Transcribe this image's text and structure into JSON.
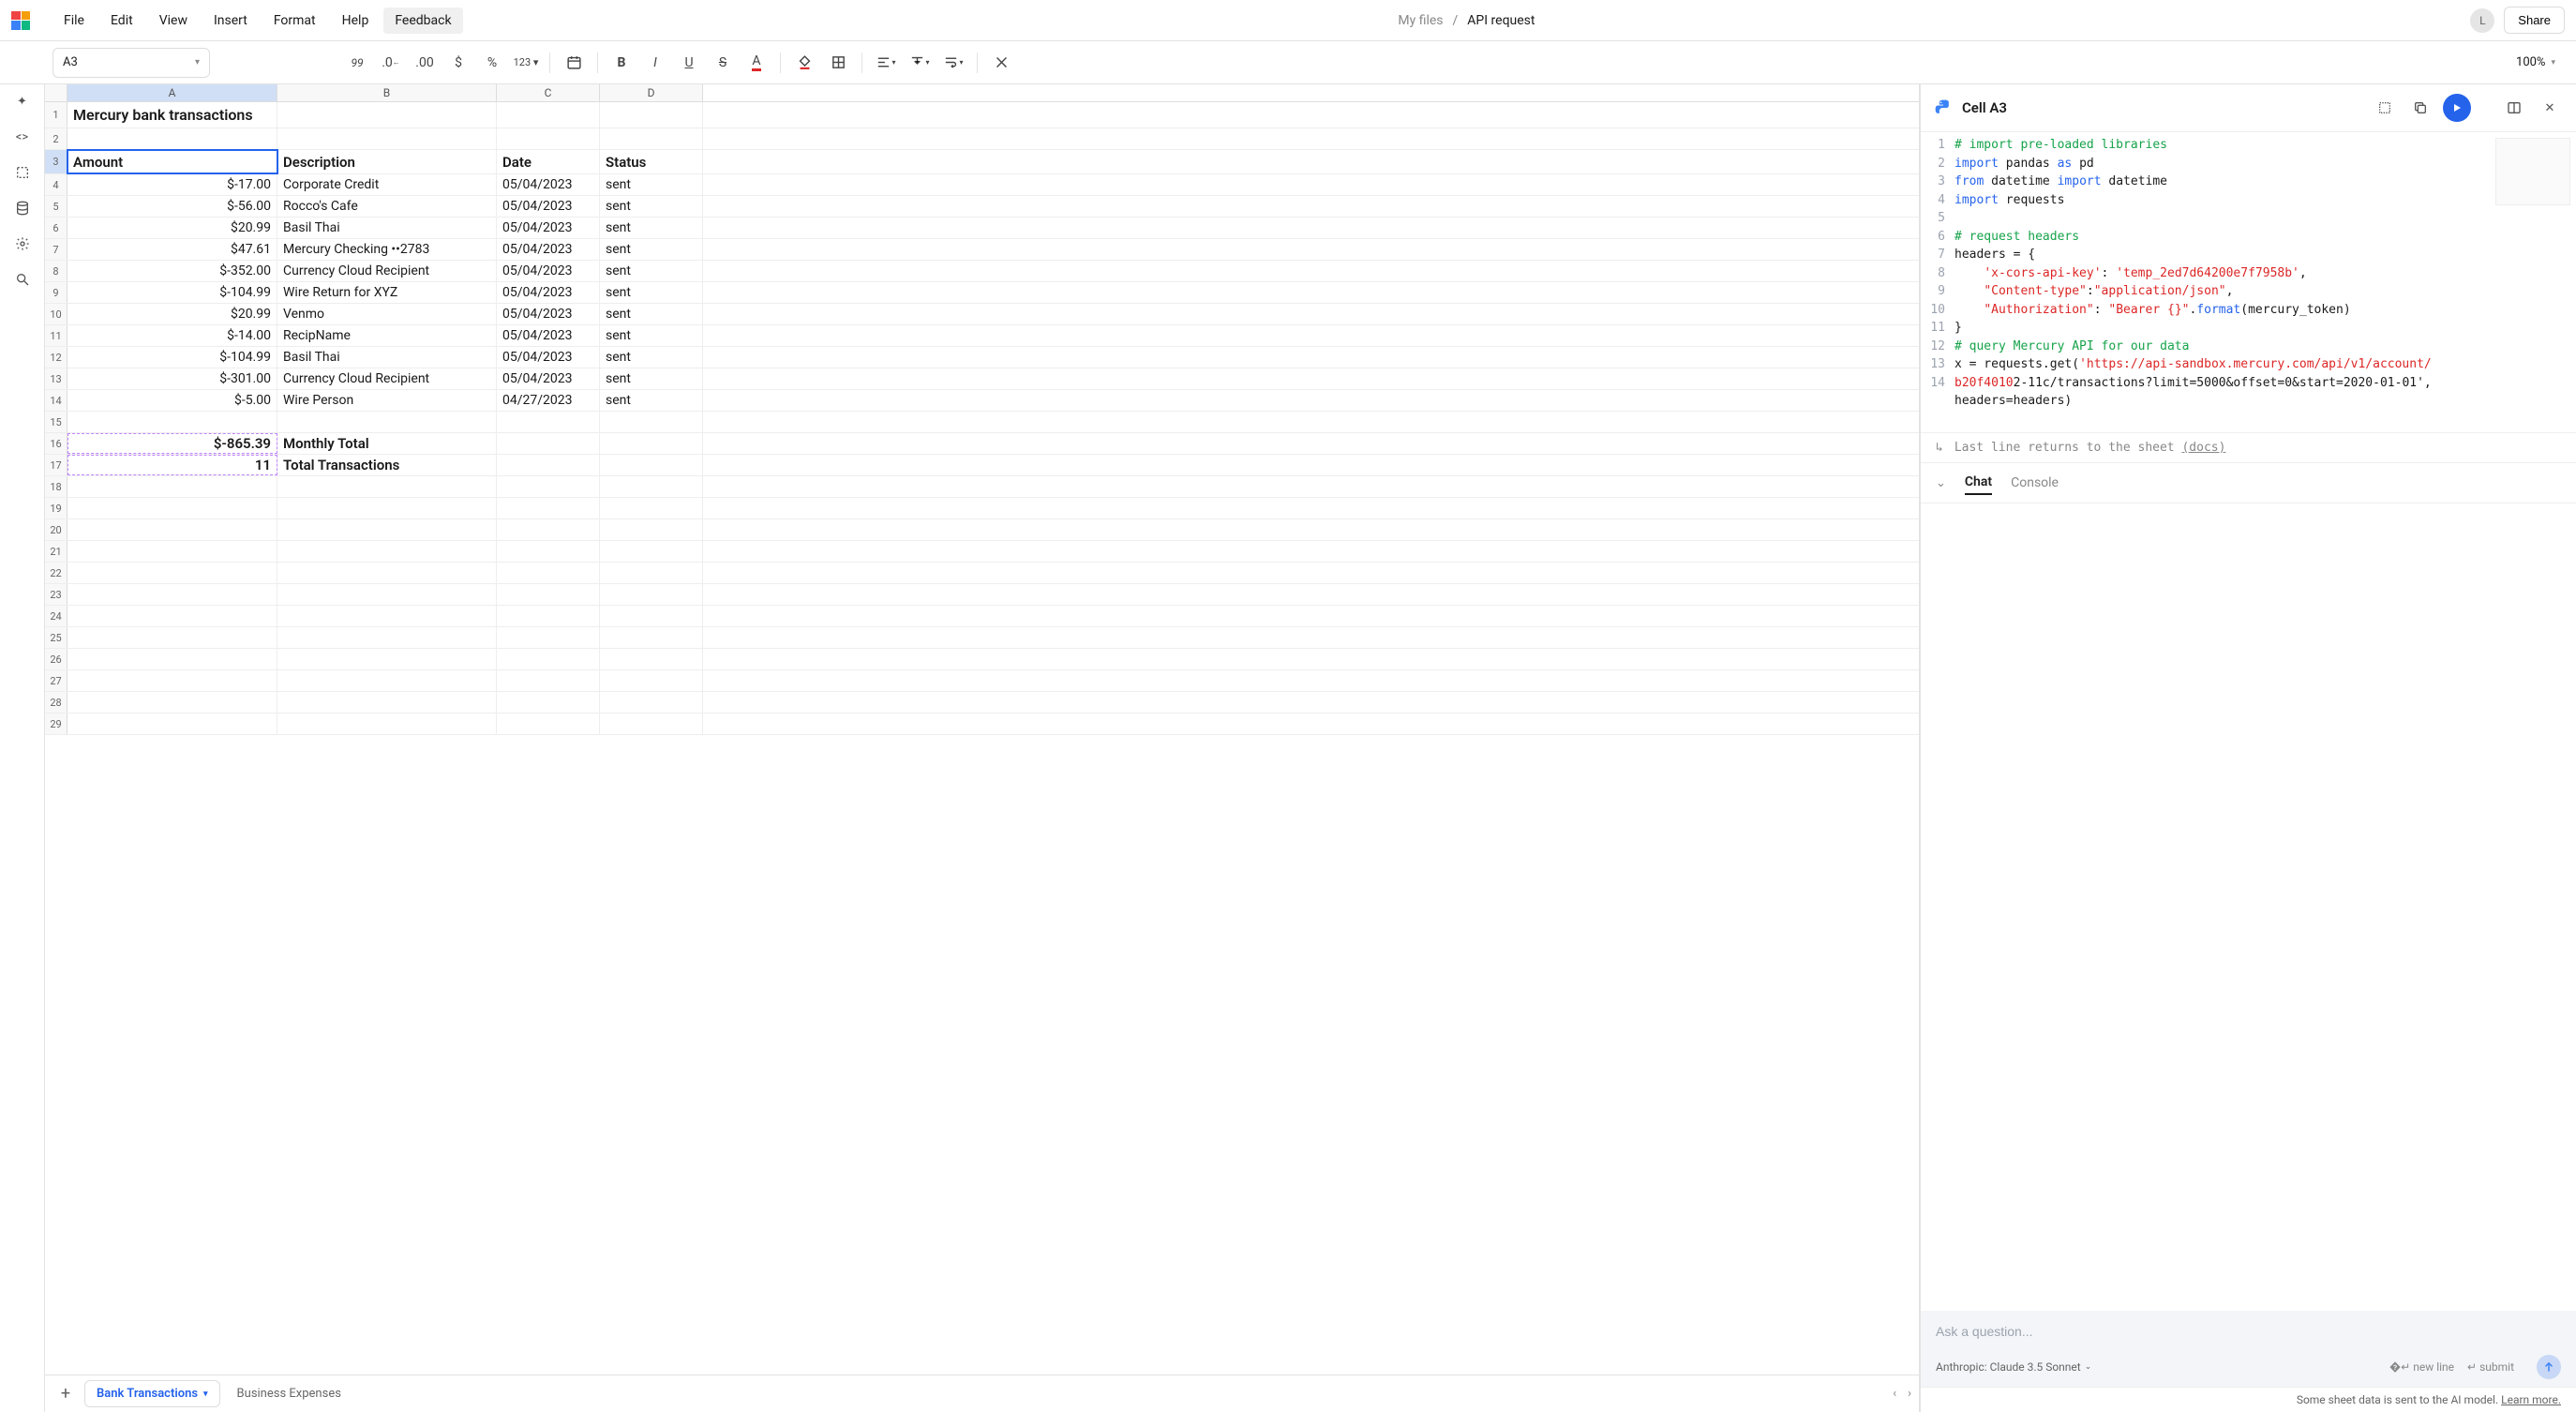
{
  "menubar": {
    "items": [
      "File",
      "Edit",
      "View",
      "Insert",
      "Format",
      "Help",
      "Feedback"
    ],
    "breadcrumb_root": "My files",
    "breadcrumb_current": "API request",
    "avatar_initial": "L",
    "share": "Share"
  },
  "toolbar": {
    "cell_ref": "A3",
    "zoom": "100%"
  },
  "sheet": {
    "columns": [
      "A",
      "B",
      "C",
      "D"
    ],
    "title": "Mercury bank transactions",
    "headers": {
      "a": "Amount",
      "b": "Description",
      "c": "Date",
      "d": "Status"
    },
    "rows": [
      {
        "a": "$-17.00",
        "b": "Corporate Credit",
        "c": "05/04/2023",
        "d": "sent"
      },
      {
        "a": "$-56.00",
        "b": "Rocco's Cafe",
        "c": "05/04/2023",
        "d": "sent"
      },
      {
        "a": "$20.99",
        "b": "Basil Thai",
        "c": "05/04/2023",
        "d": "sent"
      },
      {
        "a": "$47.61",
        "b": "Mercury Checking ••2783",
        "c": "05/04/2023",
        "d": "sent"
      },
      {
        "a": "$-352.00",
        "b": "Currency Cloud Recipient",
        "c": "05/04/2023",
        "d": "sent"
      },
      {
        "a": "$-104.99",
        "b": "Wire Return for XYZ",
        "c": "05/04/2023",
        "d": "sent"
      },
      {
        "a": "$20.99",
        "b": "Venmo",
        "c": "05/04/2023",
        "d": "sent"
      },
      {
        "a": "$-14.00",
        "b": "RecipName",
        "c": "05/04/2023",
        "d": "sent"
      },
      {
        "a": "$-104.99",
        "b": "Basil Thai",
        "c": "05/04/2023",
        "d": "sent"
      },
      {
        "a": "$-301.00",
        "b": "Currency Cloud Recipient",
        "c": "05/04/2023",
        "d": "sent"
      },
      {
        "a": "$-5.00",
        "b": "Wire Person",
        "c": "04/27/2023",
        "d": "sent"
      }
    ],
    "summary": [
      {
        "a": "$-865.39",
        "b": "Monthly Total"
      },
      {
        "a": "11",
        "b": "Total Transactions"
      }
    ],
    "tabs": [
      "Bank Transactions",
      "Business Expenses"
    ]
  },
  "panel": {
    "title": "Cell A3",
    "code_lines": [
      {
        "n": "1",
        "html": "<span class='c-comment'># import pre-loaded libraries</span>"
      },
      {
        "n": "2",
        "html": "<span class='c-kw'>import</span> pandas <span class='c-kw'>as</span> pd"
      },
      {
        "n": "3",
        "html": "<span class='c-kw'>from</span> datetime <span class='c-kw'>import</span> datetime"
      },
      {
        "n": "4",
        "html": "<span class='c-kw'>import</span> requests"
      },
      {
        "n": "5",
        "html": ""
      },
      {
        "n": "6",
        "html": "<span class='c-comment'># request headers</span>"
      },
      {
        "n": "7",
        "html": "headers = {"
      },
      {
        "n": "8",
        "html": "    <span class='c-str'>'x-cors-api-key'</span>: <span class='c-str'>'temp_2ed7d64200e7f7958b'</span>,"
      },
      {
        "n": "9",
        "html": "    <span class='c-str'>\"Content-type\"</span>:<span class='c-str'>\"application/json\"</span>,"
      },
      {
        "n": "10",
        "html": "    <span class='c-str'>\"Authorization\"</span>: <span class='c-str'>\"Bearer {}\"</span>.<span class='c-fn'>format</span>(mercury_token)"
      },
      {
        "n": "11",
        "html": "}"
      },
      {
        "n": "12",
        "html": "<span class='c-comment'># query Mercury API for our data</span>"
      },
      {
        "n": "13",
        "html": "x = requests.get(<span class='c-str'>'https://api-sandbox.mercury.com/api/v1/account/<br>b20f4010</span>2-11c/transactions?limit=5000&amp;offset=0&amp;start=2020-01-01'<span>,</span><br>headers=headers)"
      },
      {
        "n": "14",
        "html": ""
      }
    ],
    "return_text": "Last line returns to the sheet",
    "return_link": "(docs)",
    "chat_tabs": [
      "Chat",
      "Console"
    ],
    "chat_placeholder": "Ask a question...",
    "model": "Anthropic: Claude 3.5 Sonnet",
    "hint_newline": "new line",
    "hint_submit": "submit",
    "disclaimer": "Some sheet data is sent to the AI model.",
    "disclaimer_link": "Learn more."
  }
}
